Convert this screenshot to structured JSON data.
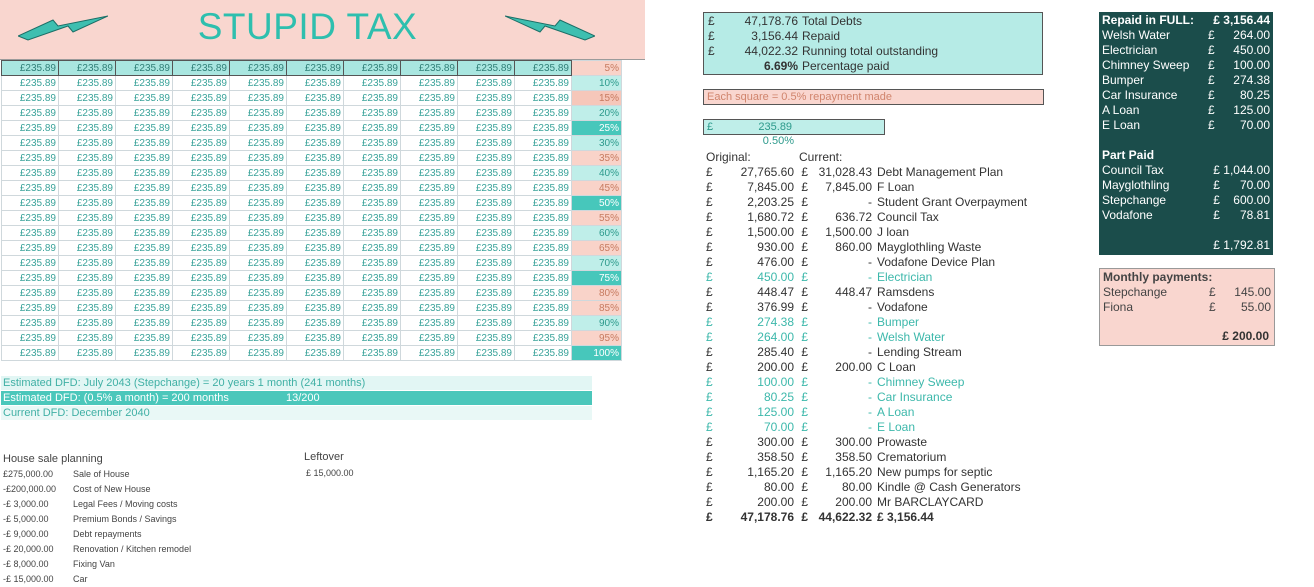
{
  "title": "STUPID TAX",
  "grid": {
    "cell_value": "£235.89",
    "columns": 10,
    "percents": [
      "5%",
      "10%",
      "15%",
      "20%",
      "25%",
      "30%",
      "35%",
      "40%",
      "45%",
      "50%",
      "55%",
      "60%",
      "65%",
      "70%",
      "75%",
      "80%",
      "85%",
      "90%",
      "95%",
      "100%"
    ],
    "paid_rows": 1
  },
  "dfd": {
    "line1": "Estimated DFD: July 2043 (Stepchange) = 20 years 1 month (241 months)",
    "line2": "Estimated DFD: (0.5% a month) = 200 months",
    "line2_right": "13/200",
    "line3": "Current DFD: December 2040"
  },
  "house": {
    "title": "House sale planning",
    "rows": [
      {
        "amount": "£275,000.00",
        "label": "Sale of House"
      },
      {
        "amount": "-£200,000.00",
        "label": "Cost of New House"
      },
      {
        "amount": "-£   3,000.00",
        "label": "Legal Fees / Moving costs"
      },
      {
        "amount": "-£   5,000.00",
        "label": "Premium Bonds / Savings"
      },
      {
        "amount": "-£   9,000.00",
        "label": "Debt repayments"
      },
      {
        "amount": "-£  20,000.00",
        "label": "Renovation / Kitchen remodel"
      },
      {
        "amount": "-£   8,000.00",
        "label": "Fixing Van"
      },
      {
        "amount": "-£  15,000.00",
        "label": "Car"
      }
    ],
    "leftover_label": "Leftover",
    "leftover_value": "£ 15,000.00"
  },
  "summary": {
    "currency": "£",
    "rows": [
      {
        "cur": "£",
        "value": "47,178.76",
        "label": "Total Debts"
      },
      {
        "cur": "£",
        "value": "3,156.44",
        "label": "Repaid"
      },
      {
        "cur": "£",
        "value": "44,022.32",
        "label": "Running total outstanding"
      },
      {
        "cur": "",
        "value": "6.69%",
        "label": "Percentage paid"
      }
    ],
    "square_note": "Each square = 0.5% repayment made",
    "square_cur": "£",
    "square_value": "235.89",
    "square_pct": "0.50%"
  },
  "debts": {
    "original_header": "Original:",
    "current_header": "Current:",
    "rows": [
      {
        "o": "27,765.60",
        "c": "31,028.43",
        "n": "Debt Management Plan",
        "struck": false
      },
      {
        "o": "7,845.00",
        "c": "7,845.00",
        "n": "F Loan",
        "struck": false
      },
      {
        "o": "2,203.25",
        "c": "-",
        "n": "Student Grant Overpayment",
        "struck": false
      },
      {
        "o": "1,680.72",
        "c": "636.72",
        "n": "Council Tax",
        "struck": false
      },
      {
        "o": "1,500.00",
        "c": "1,500.00",
        "n": "J loan",
        "struck": false
      },
      {
        "o": "930.00",
        "c": "860.00",
        "n": "Mayglothling Waste",
        "struck": false
      },
      {
        "o": "476.00",
        "c": "-",
        "n": "Vodafone Device Plan",
        "struck": false
      },
      {
        "o": "450.00",
        "c": "-",
        "n": "Electrician",
        "struck": true
      },
      {
        "o": "448.47",
        "c": "448.47",
        "n": "Ramsdens",
        "struck": false
      },
      {
        "o": "376.99",
        "c": "-",
        "n": "Vodafone",
        "struck": false
      },
      {
        "o": "274.38",
        "c": "-",
        "n": "Bumper",
        "struck": true
      },
      {
        "o": "264.00",
        "c": "-",
        "n": "Welsh Water",
        "struck": true
      },
      {
        "o": "285.40",
        "c": "-",
        "n": "Lending Stream",
        "struck": false
      },
      {
        "o": "200.00",
        "c": "200.00",
        "n": "C Loan",
        "struck": false
      },
      {
        "o": "100.00",
        "c": "-",
        "n": "Chimney Sweep",
        "struck": true
      },
      {
        "o": "80.25",
        "c": "-",
        "n": "Car Insurance",
        "struck": true
      },
      {
        "o": "125.00",
        "c": "-",
        "n": "A Loan",
        "struck": true
      },
      {
        "o": "70.00",
        "c": "-",
        "n": "E Loan",
        "struck": true
      },
      {
        "o": "300.00",
        "c": "300.00",
        "n": "Prowaste",
        "struck": false
      },
      {
        "o": "358.50",
        "c": "358.50",
        "n": "Crematorium",
        "struck": false
      },
      {
        "o": "1,165.20",
        "c": "1,165.20",
        "n": "New pumps for septic",
        "struck": false
      },
      {
        "o": "80.00",
        "c": "80.00",
        "n": "Kindle @ Cash Generators",
        "struck": false
      },
      {
        "o": "200.00",
        "c": "200.00",
        "n": "Mr BARCLAYCARD",
        "struck": false
      }
    ],
    "total_original": "47,178.76",
    "total_current": "44,622.32",
    "total_repaid": "£  3,156.44"
  },
  "repaid_full": {
    "title": "Repaid in FULL:",
    "total": "£ 3,156.44",
    "rows": [
      {
        "n": "Welsh Water",
        "v": "264.00"
      },
      {
        "n": "Electrician",
        "v": "450.00"
      },
      {
        "n": "Chimney Sweep",
        "v": "100.00"
      },
      {
        "n": "Bumper",
        "v": "274.38"
      },
      {
        "n": "Car Insurance",
        "v": "80.25"
      },
      {
        "n": "A Loan",
        "v": "125.00"
      },
      {
        "n": "E Loan",
        "v": "70.00"
      }
    ]
  },
  "part_paid": {
    "title": "Part Paid",
    "rows": [
      {
        "n": "Council Tax",
        "v": "£ 1,044.00"
      },
      {
        "n": "Mayglothling",
        "v": "£      70.00"
      },
      {
        "n": "Stepchange",
        "v": "£    600.00"
      },
      {
        "n": "Vodafone",
        "v": "£      78.81"
      }
    ],
    "total": "£ 1,792.81"
  },
  "monthly": {
    "title": "Monthly payments:",
    "rows": [
      {
        "n": "Stepchange",
        "v": "145.00"
      },
      {
        "n": "Fiona",
        "v": "55.00"
      }
    ],
    "total": "£  200.00"
  },
  "colors": {
    "accent": "#2ebfae",
    "pink": "#f9d6cf",
    "dark": "#1b4d4b",
    "mint": "#b6ebe6"
  }
}
